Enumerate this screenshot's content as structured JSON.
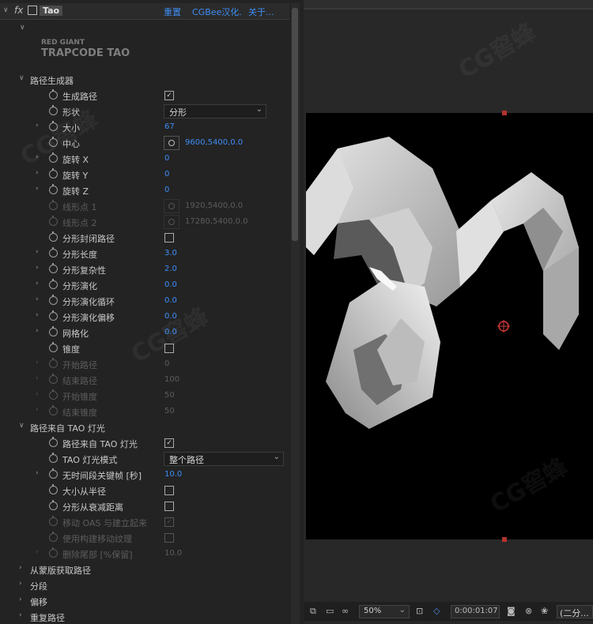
{
  "effect_header": {
    "fx_label": "fx",
    "effect_name": "Tao",
    "reset_link": "重置",
    "cgbee_link": "CGBee汉化.",
    "about_link": "关于..."
  },
  "logo": {
    "line1": "RED GIANT",
    "line2": "TRAPCODE TAO"
  },
  "rows": [
    {
      "type": "group",
      "label": "路径生成器",
      "expanded": true
    },
    {
      "type": "check",
      "label": "生成路径",
      "checked": true
    },
    {
      "type": "dropdown",
      "label": "形状",
      "value": "分形"
    },
    {
      "type": "value",
      "label": "大小",
      "value": "67",
      "chevron": true
    },
    {
      "type": "point",
      "label": "中心",
      "value": "9600,5400,0.0"
    },
    {
      "type": "value",
      "label": "旋转 X",
      "value": "0",
      "chevron": true
    },
    {
      "type": "value",
      "label": "旋转 Y",
      "value": "0",
      "chevron": true
    },
    {
      "type": "value",
      "label": "旋转 Z",
      "value": "0",
      "chevron": true
    },
    {
      "type": "point",
      "label": "线形点 1",
      "value": "1920,5400,0.0",
      "disabled": true
    },
    {
      "type": "point",
      "label": "线形点 2",
      "value": "17280,5400,0.0",
      "disabled": true
    },
    {
      "type": "check",
      "label": "分形封闭路径",
      "checked": false
    },
    {
      "type": "value",
      "label": "分形长度",
      "value": "3.0",
      "chevron": true
    },
    {
      "type": "value",
      "label": "分形复杂性",
      "value": "2.0",
      "chevron": true
    },
    {
      "type": "value",
      "label": "分形演化",
      "value": "0.0",
      "chevron": true
    },
    {
      "type": "value",
      "label": "分形演化循环",
      "value": "0.0",
      "chevron": true
    },
    {
      "type": "value",
      "label": "分形演化偏移",
      "value": "0.0",
      "chevron": true
    },
    {
      "type": "value",
      "label": "网格化",
      "value": "0.0",
      "chevron": true
    },
    {
      "type": "check",
      "label": "锥度",
      "checked": false
    },
    {
      "type": "value",
      "label": "开始路径",
      "value": "0",
      "chevron": true,
      "disabled": true
    },
    {
      "type": "value",
      "label": "结束路径",
      "value": "100",
      "chevron": true,
      "disabled": true
    },
    {
      "type": "value",
      "label": "开始锥度",
      "value": "50",
      "chevron": true,
      "disabled": true
    },
    {
      "type": "value",
      "label": "结束锥度",
      "value": "50",
      "chevron": true,
      "disabled": true
    },
    {
      "type": "group",
      "label": "路径来自 TAO 灯光",
      "expanded": true
    },
    {
      "type": "check",
      "label": "路径来自 TAO 灯光",
      "checked": true
    },
    {
      "type": "dropdown",
      "label": "TAO 灯光模式",
      "value": "整个路径",
      "wide": true
    },
    {
      "type": "value",
      "label": "无时间段关键帧 [秒]",
      "value": "10.0",
      "chevron": true
    },
    {
      "type": "check",
      "label": "大小从半径",
      "checked": false
    },
    {
      "type": "check",
      "label": "分形从衰减距离",
      "checked": false
    },
    {
      "type": "check",
      "label": "移动 OAS 与建立起来",
      "checked": true,
      "disabled": true
    },
    {
      "type": "check",
      "label": "使用构建移动纹理",
      "checked": false,
      "disabled": true
    },
    {
      "type": "value",
      "label": "删除尾部 [%保留]",
      "value": "10.0",
      "chevron": true,
      "disabled": true
    },
    {
      "type": "group",
      "label": "从蒙版获取路径",
      "expanded": false
    },
    {
      "type": "group",
      "label": "分段",
      "expanded": false
    },
    {
      "type": "group",
      "label": "偏移",
      "expanded": false
    },
    {
      "type": "group",
      "label": "重复路径",
      "expanded": false
    }
  ],
  "viewer_bar": {
    "zoom": "50%",
    "timecode": "0:00:01:07",
    "resolution": "(二分..."
  },
  "colors": {
    "accent_blue": "#3d8df5",
    "handle_red": "#b4332e",
    "panel_bg": "#232323"
  }
}
